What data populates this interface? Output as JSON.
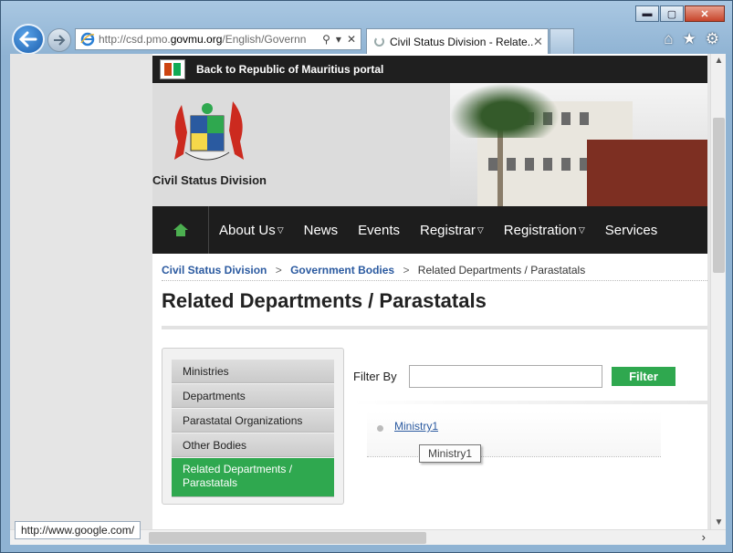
{
  "browser": {
    "url_prefix": "http://csd.pmo.",
    "url_domain": "govmu.org",
    "url_rest": "/English/Governn",
    "tab_label": "Civil Status Division - Relate...",
    "status_url": "http://www.google.com/"
  },
  "page": {
    "topbar_label": "Back to Republic of Mauritius portal",
    "site_name": "Civil Status Division",
    "nav": [
      "About Us",
      "News",
      "Events",
      "Registrar",
      "Registration",
      "Services"
    ],
    "breadcrumb": [
      "Civil Status Division",
      "Government Bodies",
      "Related Departments / Parastatals"
    ],
    "breadcrumb_sep": ">",
    "title": "Related Departments / Parastatals",
    "sidebar": [
      "Ministries",
      "Departments",
      "Parastatal Organizations",
      "Other Bodies",
      "Related Departments / Parastatals"
    ],
    "filter_label": "Filter By",
    "filter_button": "Filter",
    "filter_value": "",
    "list_item": "Ministry1",
    "tooltip": "Ministry1"
  },
  "colors": {
    "accent_green": "#2fa84f",
    "navbar": "#1d1d1d",
    "link": "#2b5aa0"
  }
}
